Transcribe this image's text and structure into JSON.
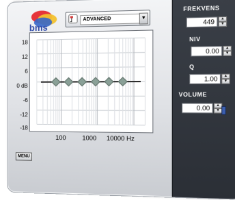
{
  "app": {
    "logo_text": "bms",
    "preset": {
      "selected": "ADVANCED"
    },
    "menu_label": "MENU"
  },
  "controls": {
    "frekvens": {
      "label": "FREKVENS",
      "value": "449"
    },
    "niv": {
      "label": "NIV",
      "value": "0.00"
    },
    "q": {
      "label": "Q",
      "value": "1.00"
    },
    "volume": {
      "label": "VOLUME",
      "value": "0.00"
    }
  },
  "colors": {
    "panel": "#2f343b",
    "node": "#8aa097",
    "line": "#2a2a2a"
  },
  "chart_data": {
    "type": "line",
    "y_ticks": [
      "18",
      "12",
      "6",
      "0 dB",
      "-6",
      "-12",
      "-18"
    ],
    "x_ticks": [
      "100",
      "1000",
      "10000 Hz"
    ],
    "ylim": [
      -18,
      18
    ],
    "xscale": "log",
    "grid": true,
    "series": [
      {
        "values": [
          0,
          0,
          0,
          0,
          0,
          0
        ]
      }
    ],
    "nodes_db": [
      0,
      0,
      0,
      0,
      0,
      0
    ]
  }
}
